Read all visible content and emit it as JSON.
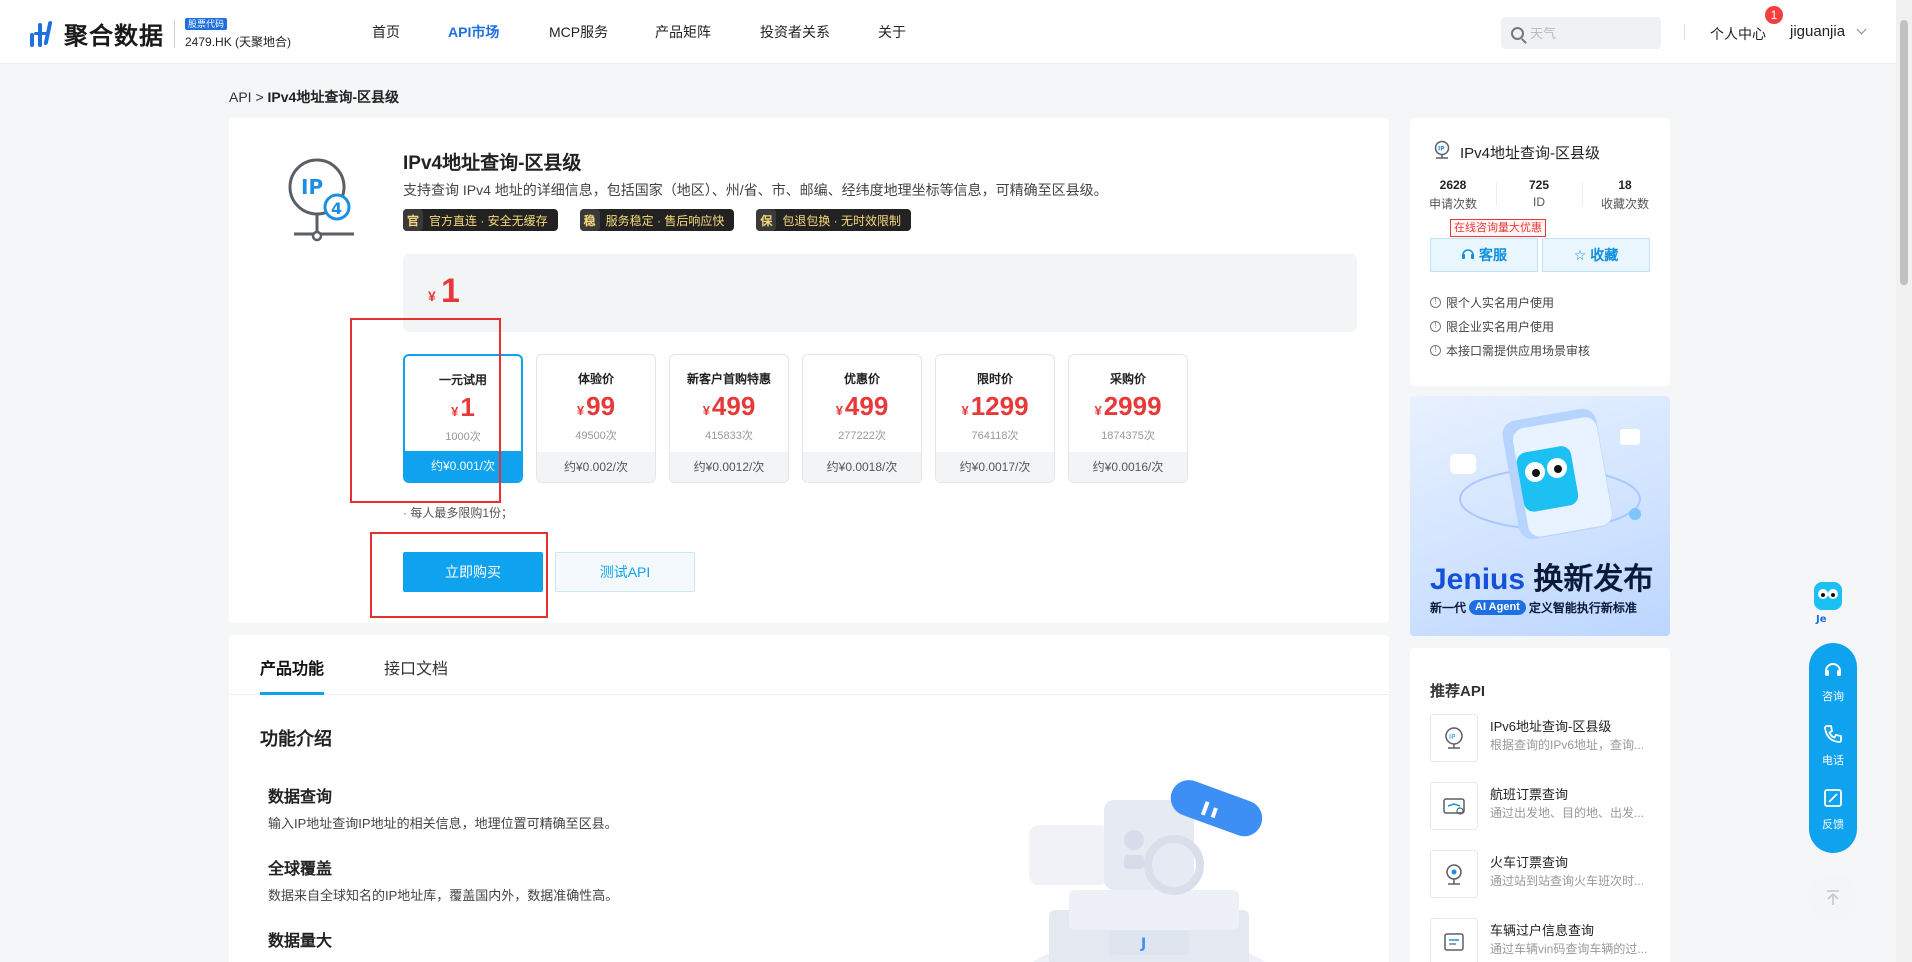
{
  "header": {
    "logo_text": "聚合数据",
    "stock_badge": "股票代码",
    "stock_code": "2479.HK (天聚地合)",
    "nav": [
      "首页",
      "API市场",
      "MCP服务",
      "产品矩阵",
      "投资者关系",
      "关于"
    ],
    "nav_active": "API市场",
    "search_placeholder": "天气",
    "user_center": "个人中心",
    "notification_count": "1",
    "username": "jiguanjia"
  },
  "breadcrumb": {
    "root": "API",
    "sep": ">",
    "current": "IPv4地址查询-区县级"
  },
  "product": {
    "title": "IPv4地址查询-区县级",
    "description": "支持查询 IPv4 地址的详细信息，包括国家（地区）、州/省、市、邮编、经纬度地理坐标等信息，可精确至区县级。",
    "badges": [
      {
        "icon": "官",
        "text": "官方直连 · 安全无缓存"
      },
      {
        "icon": "稳",
        "text": "服务稳定 · 售后响应快"
      },
      {
        "icon": "保",
        "text": "包退包换 · 无时效限制"
      }
    ],
    "price_currency": "¥",
    "price_amount": "1",
    "plans": [
      {
        "name": "一元试用",
        "currency": "¥",
        "price": "1",
        "count": "1000次",
        "unit_price": "约¥0.001/次",
        "selected": true
      },
      {
        "name": "体验价",
        "currency": "¥",
        "price": "99",
        "count": "49500次",
        "unit_price": "约¥0.002/次",
        "selected": false
      },
      {
        "name": "新客户首购特惠",
        "currency": "¥",
        "price": "499",
        "count": "415833次",
        "unit_price": "约¥0.0012/次",
        "selected": false
      },
      {
        "name": "优惠价",
        "currency": "¥",
        "price": "499",
        "count": "277222次",
        "unit_price": "约¥0.0018/次",
        "selected": false
      },
      {
        "name": "限时价",
        "currency": "¥",
        "price": "1299",
        "count": "764118次",
        "unit_price": "约¥0.0017/次",
        "selected": false
      },
      {
        "name": "采购价",
        "currency": "¥",
        "price": "2999",
        "count": "1874375次",
        "unit_price": "约¥0.0016/次",
        "selected": false
      }
    ],
    "limit_note": "· 每人最多限购1份；",
    "buy_label": "立即购买",
    "test_label": "测试API"
  },
  "tabs": {
    "items": [
      "产品功能",
      "接口文档"
    ],
    "active": "产品功能"
  },
  "features": {
    "section_title": "功能介绍",
    "items": [
      {
        "title": "数据查询",
        "desc": "输入IP地址查询IP地址的相关信息，地理位置可精确至区县。"
      },
      {
        "title": "全球覆盖",
        "desc": "数据来自全球知名的IP地址库，覆盖国内外，数据准确性高。"
      },
      {
        "title": "数据量大",
        "desc": ""
      }
    ]
  },
  "sidebar": {
    "title": "IPv4地址查询-区县级",
    "stats": [
      {
        "value": "2628",
        "label": "申请次数"
      },
      {
        "value": "725",
        "label": "ID"
      },
      {
        "value": "18",
        "label": "收藏次数"
      }
    ],
    "promo_tag": "在线咨询量大优惠",
    "service_label": "客服",
    "favorite_label": "收藏",
    "notes": [
      "限个人实名用户使用",
      "限企业实名用户使用",
      "本接口需提供应用场景审核"
    ]
  },
  "banner": {
    "title_brand": "Jenius",
    "title_rest": " 换新发布",
    "sub_pre": "新一代",
    "sub_pill": "AI Agent",
    "sub_post": "定义智能执行新标准"
  },
  "recommend": {
    "title": "推荐API",
    "items": [
      {
        "title": "IPv6地址查询-区县级",
        "desc": "根据查询的IPv6地址，查询..."
      },
      {
        "title": "航班订票查询",
        "desc": "通过出发地、目的地、出发..."
      },
      {
        "title": "火车订票查询",
        "desc": "通过站到站查询火车班次时..."
      },
      {
        "title": "车辆过户信息查询",
        "desc": "通过车辆vin码查询车辆的过..."
      }
    ]
  },
  "float": {
    "consult": "咨询",
    "phone": "电话",
    "feedback": "反馈"
  },
  "colors": {
    "accent": "#0fa3ef",
    "price": "#e8393a",
    "brand": "#1e6fe0"
  }
}
